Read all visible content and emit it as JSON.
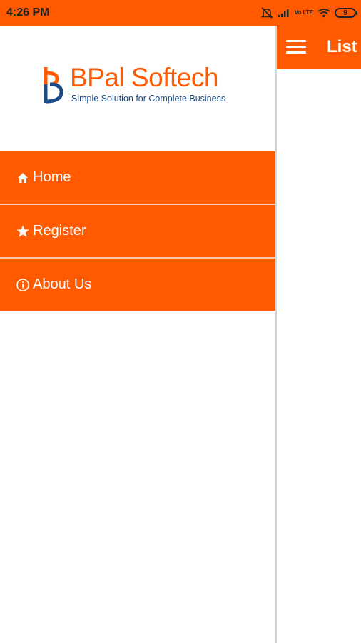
{
  "status_bar": {
    "time": "4:26 PM",
    "network_label": "Vo LTE",
    "battery_level": "9",
    "icons": [
      "mute-icon",
      "signal-icon",
      "volte-icon",
      "wifi-icon",
      "battery-icon"
    ]
  },
  "toolbar": {
    "title": "List",
    "menu_icon": "hamburger-icon"
  },
  "drawer": {
    "logo": {
      "name": "BPal Softech",
      "tagline": "Simple Solution for Complete Business"
    },
    "items": [
      {
        "label": "Home",
        "icon": "home-icon"
      },
      {
        "label": "Register",
        "icon": "star-icon"
      },
      {
        "label": "About Us",
        "icon": "info-icon"
      }
    ]
  },
  "colors": {
    "accent": "#ff5a00",
    "brand_blue": "#1b4b86",
    "background": "#ffffff"
  }
}
